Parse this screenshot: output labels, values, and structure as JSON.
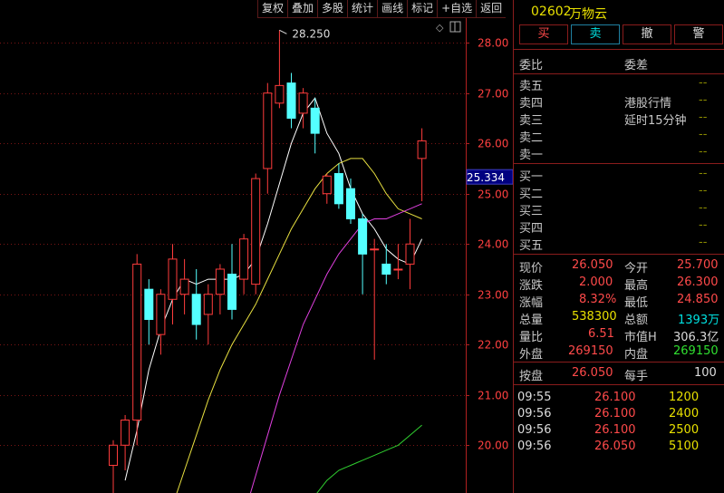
{
  "toolbar": [
    "复权",
    "叠加",
    "多股",
    "统计",
    "画线",
    "标记",
    "+自选",
    "返回"
  ],
  "header": {
    "code": "02602",
    "name": "万物云"
  },
  "trade_buttons": {
    "buy": "买",
    "sell": "卖",
    "cancel": "撤",
    "alert": "警"
  },
  "order_book": {
    "weibi_label": "委比",
    "weicha_label": "委差",
    "asks": [
      {
        "label": "卖五",
        "value": "--"
      },
      {
        "label": "卖四",
        "value": "--"
      },
      {
        "label": "卖三",
        "value": "--"
      },
      {
        "label": "卖二",
        "value": "--"
      },
      {
        "label": "卖一",
        "value": "--"
      }
    ],
    "bids": [
      {
        "label": "买一",
        "value": "--"
      },
      {
        "label": "买二",
        "value": "--"
      },
      {
        "label": "买三",
        "value": "--"
      },
      {
        "label": "买四",
        "value": "--"
      },
      {
        "label": "买五",
        "value": "--"
      }
    ],
    "note1": "港股行情",
    "note2": "延时15分钟"
  },
  "quote": {
    "xianjia_label": "现价",
    "xianjia": "26.050",
    "jinkai_label": "今开",
    "jinkai": "25.700",
    "zhangdie_label": "涨跌",
    "zhangdie": "2.000",
    "zuigao_label": "最高",
    "zuigao": "26.300",
    "zhangfu_label": "涨幅",
    "zhangfu": "8.32%",
    "zuidi_label": "最低",
    "zuidi": "24.850",
    "zongliang_label": "总量",
    "zongliang": "538300",
    "zonge_label": "总额",
    "zonge": "1393万",
    "liangbi_label": "量比",
    "liangbi": "6.51",
    "shizhi_label": "市值H",
    "shizhi": "306.3亿",
    "waipan_label": "外盘",
    "waipan": "269150",
    "neipan_label": "内盘",
    "neipan": "269150",
    "anpan_label": "按盘",
    "anpan": "26.050",
    "meishou_label": "每手",
    "meishou": "100"
  },
  "ticks": [
    {
      "time": "09:55",
      "price": "26.100",
      "vol": "1200"
    },
    {
      "time": "09:56",
      "price": "26.100",
      "vol": "2400"
    },
    {
      "time": "09:56",
      "price": "26.100",
      "vol": "2500"
    },
    {
      "time": "09:56",
      "price": "26.050",
      "vol": "5100"
    }
  ],
  "chart_data": {
    "type": "candlestick",
    "y_ticks": [
      "28.00",
      "27.00",
      "26.00",
      "25.00",
      "24.00",
      "23.00",
      "22.00",
      "21.00",
      "20.00"
    ],
    "ylim": [
      19.05,
      28.85
    ],
    "max_label": "28.250",
    "current_price_label": "25.334",
    "current_price": 25.334,
    "candles": [
      {
        "o": 19.6,
        "h": 20.1,
        "l": 19.0,
        "c": 20.0
      },
      {
        "o": 20.0,
        "h": 20.6,
        "l": 19.5,
        "c": 20.5
      },
      {
        "o": 20.5,
        "h": 23.8,
        "l": 20.0,
        "c": 23.6
      },
      {
        "o": 23.1,
        "h": 23.3,
        "l": 22.0,
        "c": 22.5
      },
      {
        "o": 22.2,
        "h": 23.1,
        "l": 21.8,
        "c": 23.0
      },
      {
        "o": 22.9,
        "h": 24.0,
        "l": 22.4,
        "c": 23.7
      },
      {
        "o": 23.0,
        "h": 23.7,
        "l": 22.6,
        "c": 23.3
      },
      {
        "o": 23.0,
        "h": 23.5,
        "l": 22.1,
        "c": 22.4
      },
      {
        "o": 22.6,
        "h": 23.2,
        "l": 22.0,
        "c": 23.0
      },
      {
        "o": 23.0,
        "h": 23.6,
        "l": 22.6,
        "c": 23.5
      },
      {
        "o": 23.4,
        "h": 24.0,
        "l": 22.5,
        "c": 22.7
      },
      {
        "o": 23.3,
        "h": 24.2,
        "l": 23.0,
        "c": 24.1
      },
      {
        "o": 23.2,
        "h": 25.4,
        "l": 23.0,
        "c": 25.3
      },
      {
        "o": 25.5,
        "h": 27.2,
        "l": 25.0,
        "c": 27.0
      },
      {
        "o": 26.8,
        "h": 28.25,
        "l": 26.7,
        "c": 27.15
      },
      {
        "o": 27.2,
        "h": 27.4,
        "l": 26.3,
        "c": 26.5
      },
      {
        "o": 26.6,
        "h": 27.1,
        "l": 26.3,
        "c": 27.0
      },
      {
        "o": 26.7,
        "h": 26.9,
        "l": 25.8,
        "c": 26.2
      },
      {
        "o": 25.0,
        "h": 25.4,
        "l": 24.8,
        "c": 25.35
      },
      {
        "o": 25.4,
        "h": 25.6,
        "l": 24.7,
        "c": 24.8
      },
      {
        "o": 25.1,
        "h": 25.3,
        "l": 24.4,
        "c": 24.5
      },
      {
        "o": 24.5,
        "h": 24.6,
        "l": 23.0,
        "c": 23.8
      },
      {
        "o": 23.9,
        "h": 24.1,
        "l": 21.7,
        "c": 23.9
      },
      {
        "o": 23.6,
        "h": 24.0,
        "l": 23.2,
        "c": 23.4
      },
      {
        "o": 23.5,
        "h": 24.0,
        "l": 23.3,
        "c": 23.5
      },
      {
        "o": 23.6,
        "h": 24.5,
        "l": 23.1,
        "c": 24.0
      },
      {
        "o": 25.7,
        "h": 26.3,
        "l": 24.85,
        "c": 26.05
      }
    ],
    "ma": [
      {
        "color": "#ffffff",
        "values": [
          null,
          19.3,
          20.3,
          21.5,
          22.3,
          22.9,
          23.3,
          23.2,
          23.3,
          23.3,
          23.3,
          23.4,
          23.7,
          24.4,
          25.2,
          26.0,
          26.6,
          26.9,
          26.2,
          25.8,
          25.1,
          24.6,
          24.3,
          23.9,
          23.7,
          23.6,
          24.1
        ]
      },
      {
        "color": "#e8e040",
        "values": [
          null,
          null,
          null,
          null,
          null,
          18.8,
          19.5,
          20.2,
          20.9,
          21.5,
          22.0,
          22.4,
          22.8,
          23.3,
          23.8,
          24.3,
          24.7,
          25.1,
          25.4,
          25.6,
          25.7,
          25.7,
          25.4,
          25.0,
          24.7,
          24.6,
          24.5
        ]
      },
      {
        "color": "#e040e0",
        "values": [
          null,
          null,
          null,
          null,
          null,
          null,
          null,
          null,
          null,
          null,
          null,
          18.6,
          19.4,
          20.2,
          21.0,
          21.7,
          22.4,
          22.9,
          23.4,
          23.8,
          24.1,
          24.4,
          24.5,
          24.5,
          24.6,
          24.7,
          24.8
        ]
      },
      {
        "color": "#30d030",
        "values": [
          null,
          null,
          null,
          null,
          null,
          null,
          null,
          null,
          null,
          null,
          null,
          null,
          null,
          null,
          null,
          null,
          null,
          19.0,
          19.3,
          19.5,
          19.6,
          19.7,
          19.8,
          19.9,
          20.0,
          20.2,
          20.4
        ]
      }
    ]
  }
}
